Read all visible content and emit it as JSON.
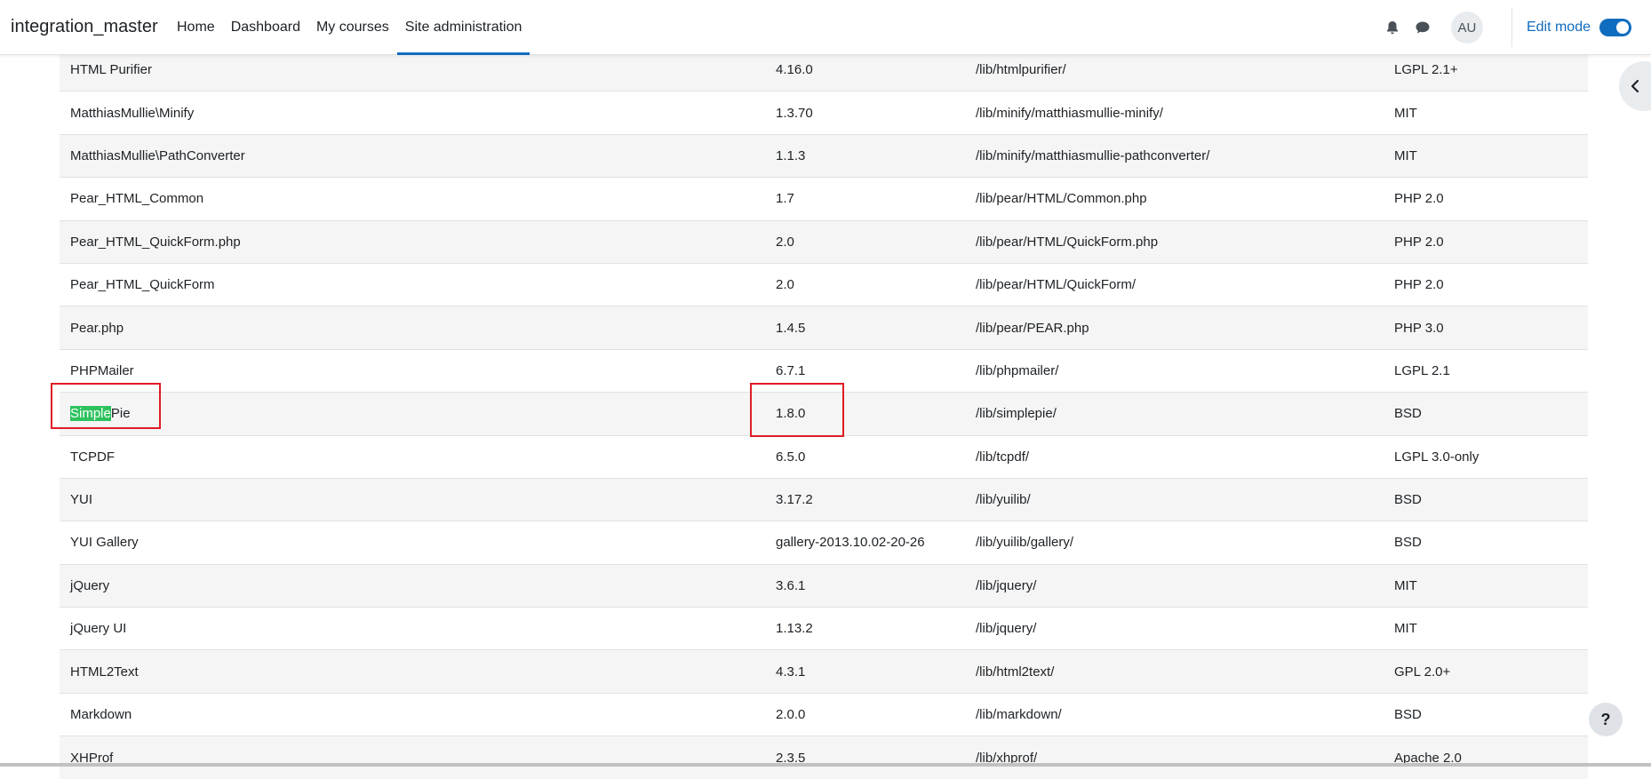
{
  "navbar": {
    "brand": "integration_master",
    "links": [
      {
        "label": "Home"
      },
      {
        "label": "Dashboard"
      },
      {
        "label": "My courses"
      },
      {
        "label": "Site administration"
      }
    ],
    "avatar_initials": "AU",
    "edit_mode_label": "Edit mode",
    "edit_mode_on": true,
    "icons": [
      "bell-icon",
      "chat-icon"
    ]
  },
  "libraries": [
    {
      "name": "HTML Purifier",
      "version": "4.16.0",
      "location": "/lib/htmlpurifier/",
      "license": "LGPL 2.1+"
    },
    {
      "name": "MatthiasMullie\\Minify",
      "version": "1.3.70",
      "location": "/lib/minify/matthiasmullie-minify/",
      "license": "MIT"
    },
    {
      "name": "MatthiasMullie\\PathConverter",
      "version": "1.1.3",
      "location": "/lib/minify/matthiasmullie-pathconverter/",
      "license": "MIT"
    },
    {
      "name": "Pear_HTML_Common",
      "version": "1.7",
      "location": "/lib/pear/HTML/Common.php",
      "license": "PHP 2.0"
    },
    {
      "name": "Pear_HTML_QuickForm.php",
      "version": "2.0",
      "location": "/lib/pear/HTML/QuickForm.php",
      "license": "PHP 2.0"
    },
    {
      "name": "Pear_HTML_QuickForm",
      "version": "2.0",
      "location": "/lib/pear/HTML/QuickForm/",
      "license": "PHP 2.0"
    },
    {
      "name": "Pear.php",
      "version": "1.4.5",
      "location": "/lib/pear/PEAR.php",
      "license": "PHP 3.0"
    },
    {
      "name": "PHPMailer",
      "version": "6.7.1",
      "location": "/lib/phpmailer/",
      "license": "LGPL 2.1"
    },
    {
      "name": "SimplePie",
      "name_highlight": "Simple",
      "name_rest": "Pie",
      "version": "1.8.0",
      "location": "/lib/simplepie/",
      "license": "BSD"
    },
    {
      "name": "TCPDF",
      "version": "6.5.0",
      "location": "/lib/tcpdf/",
      "license": "LGPL 3.0-only"
    },
    {
      "name": "YUI",
      "version": "3.17.2",
      "location": "/lib/yuilib/",
      "license": "BSD"
    },
    {
      "name": "YUI Gallery",
      "version": "gallery-2013.10.02-20-26",
      "location": "/lib/yuilib/gallery/",
      "license": "BSD"
    },
    {
      "name": "jQuery",
      "version": "3.6.1",
      "location": "/lib/jquery/",
      "license": "MIT"
    },
    {
      "name": "jQuery UI",
      "version": "1.13.2",
      "location": "/lib/jquery/",
      "license": "MIT"
    },
    {
      "name": "HTML2Text",
      "version": "4.3.1",
      "location": "/lib/html2text/",
      "license": "GPL 2.0+"
    },
    {
      "name": "Markdown",
      "version": "2.0.0",
      "location": "/lib/markdown/",
      "license": "BSD"
    },
    {
      "name": "XHProf",
      "version": "2.3.5",
      "location": "/lib/xhprof/",
      "license": "Apache 2.0"
    }
  ],
  "help_label": "?",
  "colors": {
    "accent": "#0f6cbf",
    "highlight": "#2ec25e",
    "annotation": "#e01b24"
  }
}
